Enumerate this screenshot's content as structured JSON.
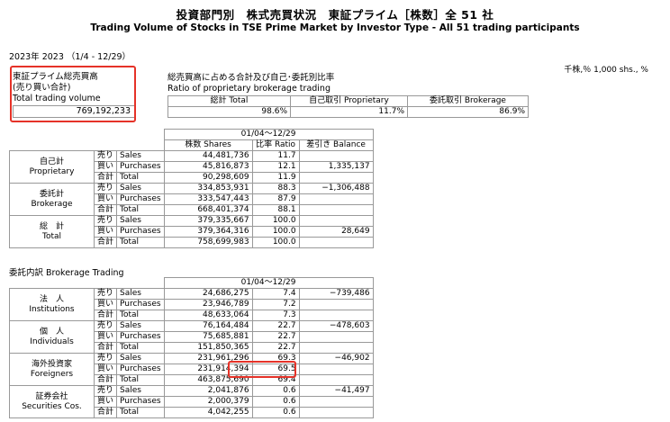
{
  "header": {
    "title_jp": "投資部門別　株式売買状況　東証プライム［株数］全 51 社",
    "title_en": "Trading Volume of Stocks in TSE Prime Market by Investor Type - All 51 trading participants",
    "period": "2023年 2023 （1/4 - 12/29）",
    "units": "千株,％ 1,000 shs., %"
  },
  "total": {
    "label_jp": "東証プライム総売買高",
    "label_jp2": "(売り買い合計)",
    "label_en": "Total trading volume",
    "value": "769,192,233"
  },
  "ratio": {
    "title_jp": "総売買高に占める合計及び自己･委託別比率",
    "title_en": "Ratio of proprietary brokerage trading",
    "headers": [
      "総計 Total",
      "自己取引 Proprietary",
      "委託取引 Brokerage"
    ],
    "values": [
      "98.6%",
      "11.7%",
      "86.9%"
    ]
  },
  "main": {
    "period_header": "01/04～12/29",
    "col_headers": [
      "株数 Shares",
      "比率 Ratio",
      "差引き Balance"
    ],
    "groups": [
      {
        "jp": "自己計",
        "en": "Proprietary",
        "rows": [
          {
            "t1": "売り",
            "t2": "Sales",
            "shares": "44,481,736",
            "ratio": "11.7",
            "bal": ""
          },
          {
            "t1": "買い",
            "t2": "Purchases",
            "shares": "45,816,873",
            "ratio": "12.1",
            "bal": "1,335,137"
          },
          {
            "t1": "合計",
            "t2": "Total",
            "shares": "90,298,609",
            "ratio": "11.9",
            "bal": ""
          }
        ]
      },
      {
        "jp": "委託計",
        "en": "Brokerage",
        "rows": [
          {
            "t1": "売り",
            "t2": "Sales",
            "shares": "334,853,931",
            "ratio": "88.3",
            "bal": "−1,306,488"
          },
          {
            "t1": "買い",
            "t2": "Purchases",
            "shares": "333,547,443",
            "ratio": "87.9",
            "bal": ""
          },
          {
            "t1": "合計",
            "t2": "Total",
            "shares": "668,401,374",
            "ratio": "88.1",
            "bal": ""
          }
        ]
      },
      {
        "jp": "総　計",
        "en": "Total",
        "rows": [
          {
            "t1": "売り",
            "t2": "Sales",
            "shares": "379,335,667",
            "ratio": "100.0",
            "bal": ""
          },
          {
            "t1": "買い",
            "t2": "Purchases",
            "shares": "379,364,316",
            "ratio": "100.0",
            "bal": "28,649"
          },
          {
            "t1": "合計",
            "t2": "Total",
            "shares": "758,699,983",
            "ratio": "100.0",
            "bal": ""
          }
        ]
      }
    ]
  },
  "brokerage": {
    "label": "委託内訳 Brokerage Trading",
    "period_header": "01/04～12/29",
    "groups": [
      {
        "jp": "法　人",
        "en": "Institutions",
        "rows": [
          {
            "t1": "売り",
            "t2": "Sales",
            "shares": "24,686,275",
            "ratio": "7.4",
            "bal": "−739,486"
          },
          {
            "t1": "買い",
            "t2": "Purchases",
            "shares": "23,946,789",
            "ratio": "7.2",
            "bal": ""
          },
          {
            "t1": "合計",
            "t2": "Total",
            "shares": "48,633,064",
            "ratio": "7.3",
            "bal": ""
          }
        ]
      },
      {
        "jp": "個　人",
        "en": "Individuals",
        "rows": [
          {
            "t1": "売り",
            "t2": "Sales",
            "shares": "76,164,484",
            "ratio": "22.7",
            "bal": "−478,603"
          },
          {
            "t1": "買い",
            "t2": "Purchases",
            "shares": "75,685,881",
            "ratio": "22.7",
            "bal": ""
          },
          {
            "t1": "合計",
            "t2": "Total",
            "shares": "151,850,365",
            "ratio": "22.7",
            "bal": ""
          }
        ]
      },
      {
        "jp": "海外投資家",
        "en": "Foreigners",
        "rows": [
          {
            "t1": "売り",
            "t2": "Sales",
            "shares": "231,961,296",
            "ratio": "69.3",
            "bal": "−46,902"
          },
          {
            "t1": "買い",
            "t2": "Purchases",
            "shares": "231,914,394",
            "ratio": "69.5",
            "bal": ""
          },
          {
            "t1": "合計",
            "t2": "Total",
            "shares": "463,875,690",
            "ratio": "69.4",
            "bal": ""
          }
        ]
      },
      {
        "jp": "証券会社",
        "en": "Securities Cos.",
        "rows": [
          {
            "t1": "売り",
            "t2": "Sales",
            "shares": "2,041,876",
            "ratio": "0.6",
            "bal": "−41,497"
          },
          {
            "t1": "買い",
            "t2": "Purchases",
            "shares": "2,000,379",
            "ratio": "0.6",
            "bal": ""
          },
          {
            "t1": "合計",
            "t2": "Total",
            "shares": "4,042,255",
            "ratio": "0.6",
            "bal": ""
          }
        ]
      }
    ]
  },
  "highlight_color": "#e53228"
}
